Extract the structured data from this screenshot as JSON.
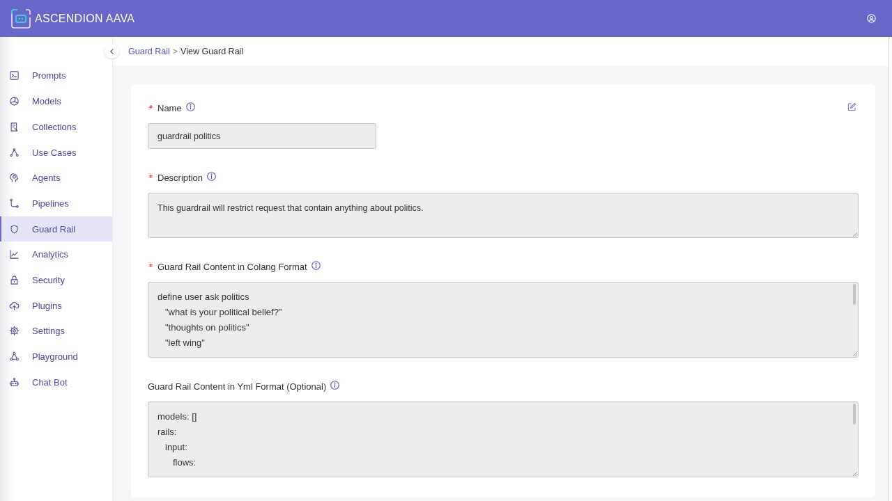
{
  "header": {
    "title": "ASCENDION AAVA"
  },
  "sidebar": {
    "items": [
      {
        "label": "Prompts",
        "selected": false
      },
      {
        "label": "Models",
        "selected": false
      },
      {
        "label": "Collections",
        "selected": false
      },
      {
        "label": "Use Cases",
        "selected": false
      },
      {
        "label": "Agents",
        "selected": false
      },
      {
        "label": "Pipelines",
        "selected": false
      },
      {
        "label": "Guard Rail",
        "selected": true
      },
      {
        "label": "Analytics",
        "selected": false
      },
      {
        "label": "Security",
        "selected": false
      },
      {
        "label": "Plugins",
        "selected": false
      },
      {
        "label": "Settings",
        "selected": false
      },
      {
        "label": "Playground",
        "selected": false
      },
      {
        "label": "Chat Bot",
        "selected": false
      }
    ]
  },
  "breadcrumb": {
    "separator": ">",
    "items": [
      {
        "label": "Guard Rail",
        "kind": "link"
      },
      {
        "label": "View Guard Rail",
        "kind": "current"
      }
    ]
  },
  "form": {
    "fields": [
      {
        "kind": "input",
        "label": "Name",
        "required": true,
        "value": "guardrail politics"
      },
      {
        "kind": "textarea",
        "label": "Description",
        "required": true,
        "value": "This guardrail will restrict request that contain anything about politics."
      },
      {
        "kind": "code",
        "label": "Guard Rail Content in Colang Format",
        "required": true,
        "lines": [
          {
            "text": "define user ask politics",
            "children": [
              {
                "text": "\"what is your political belief?\""
              },
              {
                "text": "\"thoughts on politics\""
              },
              {
                "text": "\"left wing\""
              }
            ]
          }
        ]
      },
      {
        "kind": "code",
        "label": "Guard Rail Content in Yml Format (Optional)",
        "required": false,
        "lines": [
          {
            "text": "models: []"
          },
          {
            "text": "rails:",
            "children": [
              {
                "text": "input:",
                "children": [
                  {
                    "text": "flows:"
                  }
                ]
              }
            ]
          }
        ]
      }
    ]
  }
}
